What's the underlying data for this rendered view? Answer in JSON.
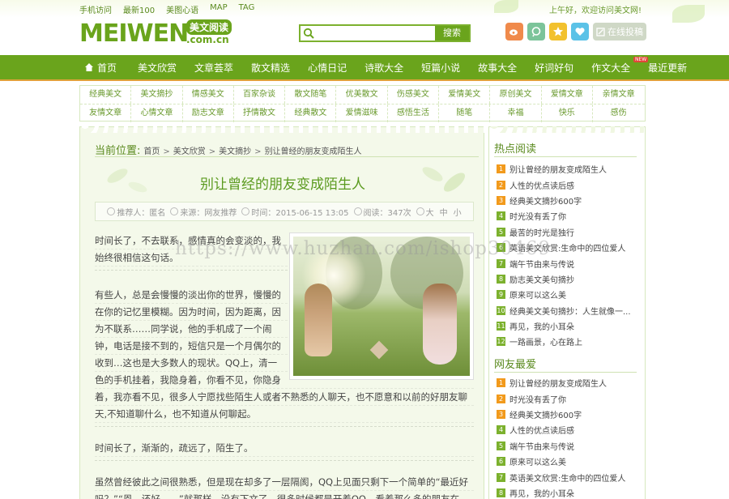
{
  "topbar": {
    "links": [
      "手机访问",
      "最新100",
      "美图心语",
      "MAP",
      "TAG"
    ],
    "greeting": "上午好，欢迎访问美文网!"
  },
  "logo": {
    "main": "MEIWEN",
    "cn": "美文阅读",
    "domain": ".com.cn"
  },
  "search": {
    "value": "",
    "placeholder": "",
    "button": "搜索"
  },
  "social": {
    "icons": [
      "weibo-icon",
      "tqq-icon",
      "star-icon",
      "heart-icon"
    ],
    "colors": [
      "#f08a4b",
      "#7cc49a",
      "#f2c12e",
      "#5bc2e7"
    ],
    "submit": "在线投稿"
  },
  "nav": {
    "home": "首页",
    "items": [
      "美文欣赏",
      "文章荟萃",
      "散文精选",
      "心情日记",
      "诗歌大全",
      "短篇小说",
      "故事大全",
      "好词好句",
      "作文大全",
      "最近更新"
    ],
    "badge": "NEW"
  },
  "subnav": {
    "row1": [
      "经典美文",
      "美文摘抄",
      "情感美文",
      "百家杂谈",
      "散文随笔",
      "优美散文",
      "伤感美文",
      "爱情美文",
      "原创美文",
      "爱情文章",
      "亲情文章"
    ],
    "row2": [
      "友情文章",
      "心情文章",
      "励志文章",
      "抒情散文",
      "经典散文",
      "爱情滋味",
      "感悟生活",
      "随笔",
      "幸福",
      "快乐",
      "感伤"
    ]
  },
  "breadcrumb": {
    "lead": "当前位置:",
    "items": [
      "首页",
      "美文欣赏",
      "美文摘抄",
      "别让曾经的朋友变成陌生人"
    ]
  },
  "article": {
    "title": "别让曾经的朋友变成陌生人",
    "meta": {
      "author": "推荐人：匿名",
      "source": "来源：网友推荐",
      "time": "时间：2015-06-15 13:05",
      "views": "阅读：347次",
      "font_label": "大",
      "font_mid": "中",
      "font_small": "小"
    },
    "paragraphs": [
      [
        "时间长了，不去联系，感情真的会变淡的，我",
        "始终很相信这句话。"
      ],
      [
        "有些人，总是会慢慢的淡出你的世界，慢慢的",
        "在你的记忆里模糊。因为时间，因为距离，因",
        "为不联系……同学说，他的手机成了一个闹",
        "钟，电话是接不到的，短信只是一个月偶尔的",
        "收到…这也是大多数人的现状。QQ上，清一",
        "色的手机挂着，我隐身着，你看不见，你隐身",
        "着，我亦看不见，很多人宁愿找些陌生人或者不熟悉的人聊天，也不愿意和以前的好朋友聊",
        "天,不知道聊什么，也不知道从何聊起。"
      ],
      [
        "时间长了，渐渐的，疏远了，陌生了。"
      ],
      [
        "虽然曾经彼此之间很熟悉，但是现在却多了一层隔阂，QQ上见面只剩下一个简单的“最近好",
        "吗？”“恩，还好……”就那样，没有下文了。很多时候都是开着QQ，看着那么多的朋友在"
      ]
    ]
  },
  "sidebar": {
    "hot_title": "热点阅读",
    "hot": [
      "别让曾经的朋友变成陌生人",
      "人性的优点读后感",
      "经典美文摘抄600字",
      "时光没有丢了你",
      "最苦的时光是独行",
      "英语美文欣赏:生命中的四位爱人",
      "端午节由来与传说",
      "励志美文美句摘抄",
      "原来可以这么美",
      "经典美文美句摘抄：人生就像一...",
      "再见，我的小耳朵",
      "一路画景，心在路上"
    ],
    "fav_title": "网友最爱",
    "fav": [
      "别让曾经的朋友变成陌生人",
      "时光没有丢了你",
      "经典美文摘抄600字",
      "人性的优点读后感",
      "端午节由来与传说",
      "原来可以这么美",
      "英语美文欣赏:生命中的四位爱人",
      "再见，我的小耳朵"
    ]
  },
  "watermark": "https://www.huzhan.com/ishop30469"
}
